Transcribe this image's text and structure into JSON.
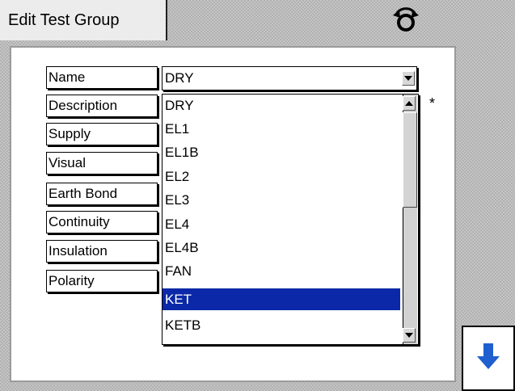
{
  "tab": {
    "title": "Edit Test Group"
  },
  "icons": {
    "sync": "sync-icon",
    "down": "arrow-down-icon"
  },
  "form": {
    "labels": [
      "Name",
      "Description",
      "Supply",
      "Visual",
      "Earth Bond",
      "Continuity",
      "Insulation",
      "Polarity"
    ],
    "name_value": "DRY",
    "required_marker": "*"
  },
  "dropdown": {
    "options": [
      "DRY",
      "EL1",
      "EL1B",
      "EL2",
      "EL3",
      "EL4",
      "EL4B",
      "FAN",
      "KET",
      "KETB"
    ],
    "selected": "KET"
  },
  "colors": {
    "selection": "#0a28a8",
    "arrow": "#1f5fcf"
  }
}
